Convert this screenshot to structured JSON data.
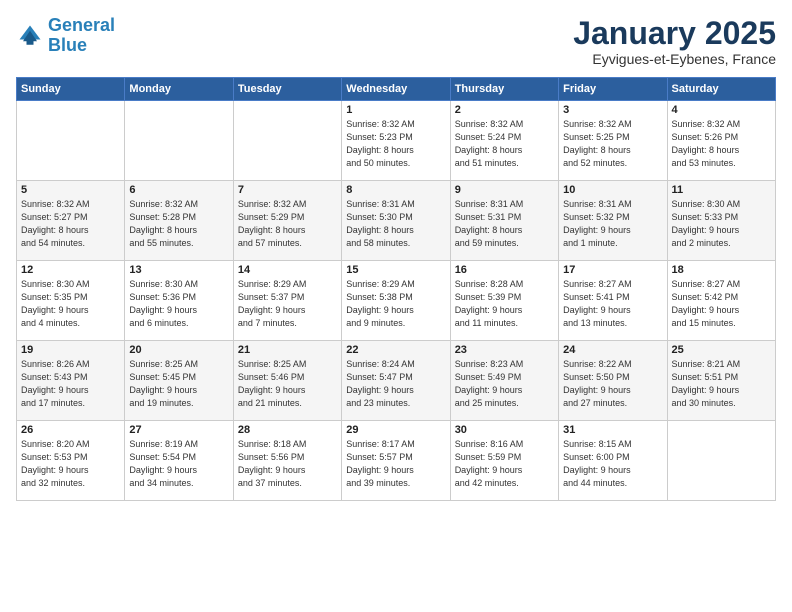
{
  "header": {
    "logo_line1": "General",
    "logo_line2": "Blue",
    "month": "January 2025",
    "location": "Eyvigues-et-Eybenes, France"
  },
  "weekdays": [
    "Sunday",
    "Monday",
    "Tuesday",
    "Wednesday",
    "Thursday",
    "Friday",
    "Saturday"
  ],
  "weeks": [
    [
      {
        "day": "",
        "info": ""
      },
      {
        "day": "",
        "info": ""
      },
      {
        "day": "",
        "info": ""
      },
      {
        "day": "1",
        "info": "Sunrise: 8:32 AM\nSunset: 5:23 PM\nDaylight: 8 hours\nand 50 minutes."
      },
      {
        "day": "2",
        "info": "Sunrise: 8:32 AM\nSunset: 5:24 PM\nDaylight: 8 hours\nand 51 minutes."
      },
      {
        "day": "3",
        "info": "Sunrise: 8:32 AM\nSunset: 5:25 PM\nDaylight: 8 hours\nand 52 minutes."
      },
      {
        "day": "4",
        "info": "Sunrise: 8:32 AM\nSunset: 5:26 PM\nDaylight: 8 hours\nand 53 minutes."
      }
    ],
    [
      {
        "day": "5",
        "info": "Sunrise: 8:32 AM\nSunset: 5:27 PM\nDaylight: 8 hours\nand 54 minutes."
      },
      {
        "day": "6",
        "info": "Sunrise: 8:32 AM\nSunset: 5:28 PM\nDaylight: 8 hours\nand 55 minutes."
      },
      {
        "day": "7",
        "info": "Sunrise: 8:32 AM\nSunset: 5:29 PM\nDaylight: 8 hours\nand 57 minutes."
      },
      {
        "day": "8",
        "info": "Sunrise: 8:31 AM\nSunset: 5:30 PM\nDaylight: 8 hours\nand 58 minutes."
      },
      {
        "day": "9",
        "info": "Sunrise: 8:31 AM\nSunset: 5:31 PM\nDaylight: 8 hours\nand 59 minutes."
      },
      {
        "day": "10",
        "info": "Sunrise: 8:31 AM\nSunset: 5:32 PM\nDaylight: 9 hours\nand 1 minute."
      },
      {
        "day": "11",
        "info": "Sunrise: 8:30 AM\nSunset: 5:33 PM\nDaylight: 9 hours\nand 2 minutes."
      }
    ],
    [
      {
        "day": "12",
        "info": "Sunrise: 8:30 AM\nSunset: 5:35 PM\nDaylight: 9 hours\nand 4 minutes."
      },
      {
        "day": "13",
        "info": "Sunrise: 8:30 AM\nSunset: 5:36 PM\nDaylight: 9 hours\nand 6 minutes."
      },
      {
        "day": "14",
        "info": "Sunrise: 8:29 AM\nSunset: 5:37 PM\nDaylight: 9 hours\nand 7 minutes."
      },
      {
        "day": "15",
        "info": "Sunrise: 8:29 AM\nSunset: 5:38 PM\nDaylight: 9 hours\nand 9 minutes."
      },
      {
        "day": "16",
        "info": "Sunrise: 8:28 AM\nSunset: 5:39 PM\nDaylight: 9 hours\nand 11 minutes."
      },
      {
        "day": "17",
        "info": "Sunrise: 8:27 AM\nSunset: 5:41 PM\nDaylight: 9 hours\nand 13 minutes."
      },
      {
        "day": "18",
        "info": "Sunrise: 8:27 AM\nSunset: 5:42 PM\nDaylight: 9 hours\nand 15 minutes."
      }
    ],
    [
      {
        "day": "19",
        "info": "Sunrise: 8:26 AM\nSunset: 5:43 PM\nDaylight: 9 hours\nand 17 minutes."
      },
      {
        "day": "20",
        "info": "Sunrise: 8:25 AM\nSunset: 5:45 PM\nDaylight: 9 hours\nand 19 minutes."
      },
      {
        "day": "21",
        "info": "Sunrise: 8:25 AM\nSunset: 5:46 PM\nDaylight: 9 hours\nand 21 minutes."
      },
      {
        "day": "22",
        "info": "Sunrise: 8:24 AM\nSunset: 5:47 PM\nDaylight: 9 hours\nand 23 minutes."
      },
      {
        "day": "23",
        "info": "Sunrise: 8:23 AM\nSunset: 5:49 PM\nDaylight: 9 hours\nand 25 minutes."
      },
      {
        "day": "24",
        "info": "Sunrise: 8:22 AM\nSunset: 5:50 PM\nDaylight: 9 hours\nand 27 minutes."
      },
      {
        "day": "25",
        "info": "Sunrise: 8:21 AM\nSunset: 5:51 PM\nDaylight: 9 hours\nand 30 minutes."
      }
    ],
    [
      {
        "day": "26",
        "info": "Sunrise: 8:20 AM\nSunset: 5:53 PM\nDaylight: 9 hours\nand 32 minutes."
      },
      {
        "day": "27",
        "info": "Sunrise: 8:19 AM\nSunset: 5:54 PM\nDaylight: 9 hours\nand 34 minutes."
      },
      {
        "day": "28",
        "info": "Sunrise: 8:18 AM\nSunset: 5:56 PM\nDaylight: 9 hours\nand 37 minutes."
      },
      {
        "day": "29",
        "info": "Sunrise: 8:17 AM\nSunset: 5:57 PM\nDaylight: 9 hours\nand 39 minutes."
      },
      {
        "day": "30",
        "info": "Sunrise: 8:16 AM\nSunset: 5:59 PM\nDaylight: 9 hours\nand 42 minutes."
      },
      {
        "day": "31",
        "info": "Sunrise: 8:15 AM\nSunset: 6:00 PM\nDaylight: 9 hours\nand 44 minutes."
      },
      {
        "day": "",
        "info": ""
      }
    ]
  ]
}
